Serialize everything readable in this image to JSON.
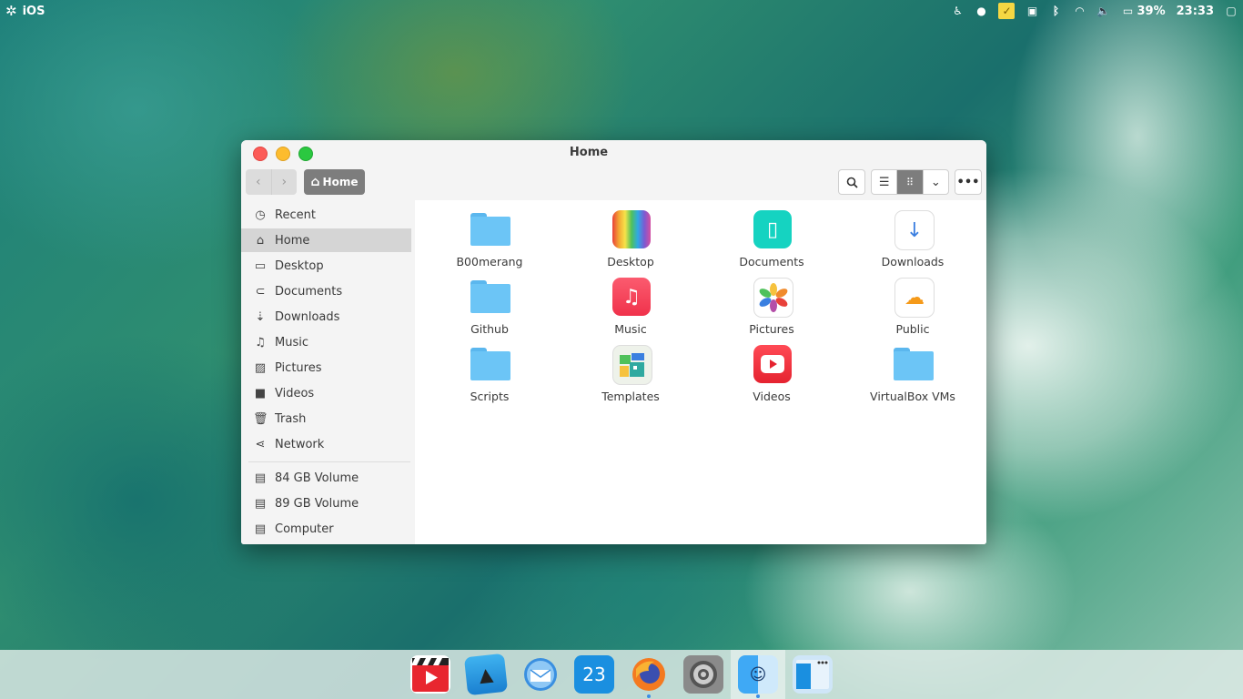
{
  "panel": {
    "activities_label": "iOS",
    "battery": "39%",
    "clock": "23:33"
  },
  "window": {
    "title": "Home",
    "path_label": "Home"
  },
  "sidebar": {
    "places": [
      {
        "label": "Recent",
        "icon": "clock-icon"
      },
      {
        "label": "Home",
        "icon": "home-icon"
      },
      {
        "label": "Desktop",
        "icon": "monitor-icon"
      },
      {
        "label": "Documents",
        "icon": "paperclip-icon"
      },
      {
        "label": "Downloads",
        "icon": "download-icon"
      },
      {
        "label": "Music",
        "icon": "music-note-icon"
      },
      {
        "label": "Pictures",
        "icon": "picture-icon"
      },
      {
        "label": "Videos",
        "icon": "camera-icon"
      },
      {
        "label": "Trash",
        "icon": "trash-icon"
      },
      {
        "label": "Network",
        "icon": "share-icon"
      }
    ],
    "devices": [
      {
        "label": "84 GB Volume",
        "icon": "drive-icon"
      },
      {
        "label": "89 GB Volume",
        "icon": "drive-icon"
      },
      {
        "label": "Computer",
        "icon": "drive-icon"
      }
    ]
  },
  "files": [
    {
      "label": "B00merang",
      "icon": "folder-icon"
    },
    {
      "label": "Desktop",
      "icon": "desktop-folder-icon"
    },
    {
      "label": "Documents",
      "icon": "documents-folder-icon"
    },
    {
      "label": "Downloads",
      "icon": "downloads-folder-icon"
    },
    {
      "label": "Github",
      "icon": "folder-icon"
    },
    {
      "label": "Music",
      "icon": "music-folder-icon"
    },
    {
      "label": "Pictures",
      "icon": "pictures-folder-icon"
    },
    {
      "label": "Public",
      "icon": "public-folder-icon"
    },
    {
      "label": "Scripts",
      "icon": "folder-icon"
    },
    {
      "label": "Templates",
      "icon": "templates-folder-icon"
    },
    {
      "label": "Videos",
      "icon": "videos-folder-icon"
    },
    {
      "label": "VirtualBox VMs",
      "icon": "folder-icon"
    }
  ],
  "dock": {
    "calendar_day": "23",
    "apps": [
      "video-player-icon",
      "wine-icon",
      "mail-icon",
      "calendar-icon",
      "firefox-icon",
      "system-settings-icon",
      "finder-icon",
      "window-manager-icon"
    ]
  }
}
